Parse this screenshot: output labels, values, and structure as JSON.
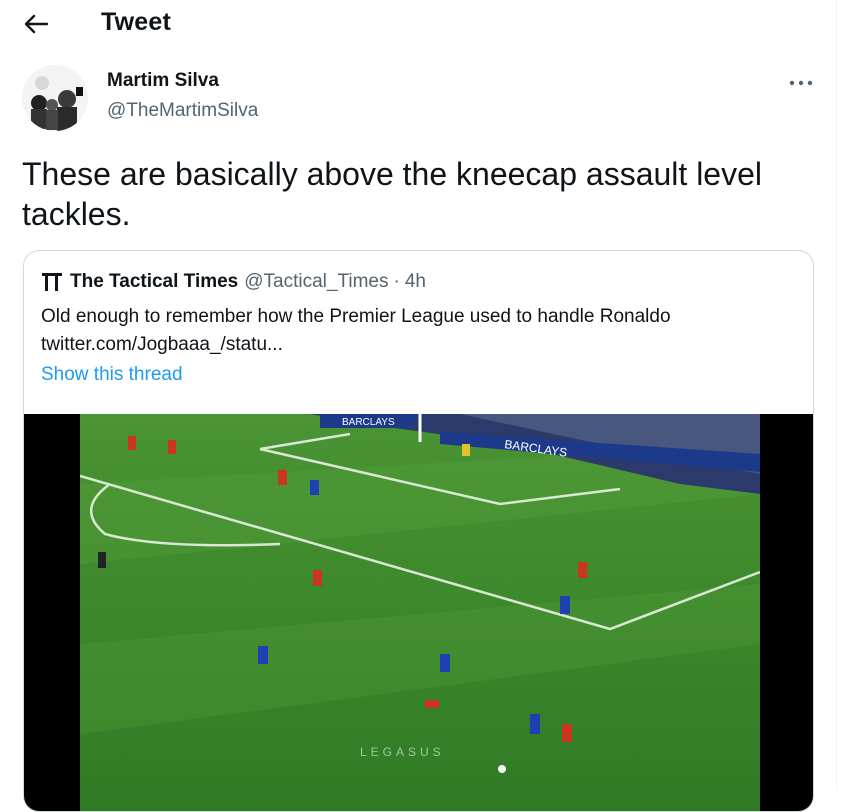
{
  "header": {
    "title": "Tweet",
    "back_icon": "arrow-left-icon"
  },
  "tweet": {
    "author_name": "Martim Silva",
    "author_handle": "@TheMartimSilva",
    "text": "These are basically above the kneecap assault level tackles.",
    "more_icon": "more-horizontal-icon"
  },
  "quoted": {
    "logo": "tactical-times-logo",
    "name": "The Tactical Times",
    "handle": "@Tactical_Times",
    "separator": "·",
    "time": "4h",
    "text_line1": "Old enough to remember how the Premier League used to handle Ronaldo",
    "text_line2": "twitter.com/Jogbaaa_/statu...",
    "show_thread": "Show this thread",
    "video": {
      "ad_board_1": "BARCLAYS",
      "ad_board_2": "BARCLAYS",
      "watermark": "LEGASUS"
    }
  },
  "colors": {
    "link": "#1d9bf0",
    "secondary_text": "#536471",
    "border": "#cfd9de",
    "pitch_green": "#3f8a2c"
  }
}
